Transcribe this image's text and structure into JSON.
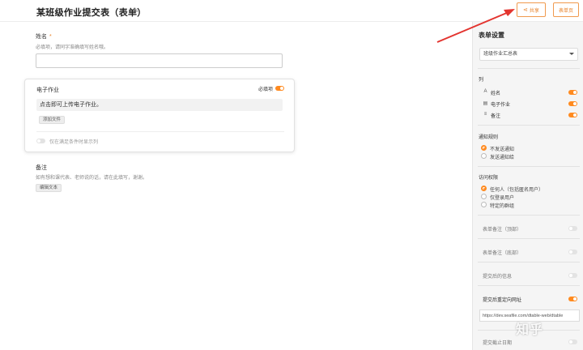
{
  "header": {
    "title": "某班级作业提交表（表单）",
    "share_label": "共享",
    "form_page_label": "表单页"
  },
  "form": {
    "name_field": {
      "label": "姓名",
      "required_mark": "*",
      "help": "必填项，请同字准确填写姓名哦。"
    },
    "file_field": {
      "title": "电子作业",
      "required_label": "必填项",
      "upload_hint": "点击即可上传电子作业。",
      "add_file_label": "添加文件",
      "condition_label": "仅在满足条件时显示列"
    },
    "note_field": {
      "label": "备注",
      "help": "如有想和课代表、老师说的话，请在此填写，谢谢。",
      "edit_text_label": "编辑文本"
    }
  },
  "panel": {
    "title": "表单设置",
    "table_select": "班级作业汇总表",
    "columns_label": "列",
    "columns": [
      {
        "icon": "A",
        "name": "姓名"
      },
      {
        "icon": "▤",
        "name": "电子作业"
      },
      {
        "icon": "≡",
        "name": "备注"
      }
    ],
    "notification_label": "通知规则",
    "notification_options": [
      "不发送通知",
      "发送通知给"
    ],
    "access_label": "访问权限",
    "access_options": [
      "任何人（包括匿名用户）",
      "仅登录用户",
      "特定的群组"
    ],
    "settings": [
      "表单备注（顶部）",
      "表单备注（底部）",
      "提交后的信息",
      "提交后重定向网址",
      "提交截止日期"
    ],
    "redirect_url": "https://dev.seafile.com/dtable-web/dtable"
  },
  "watermark": "知乎",
  "colors": {
    "accent": "#ff8a1f",
    "annotation_arrow": "#e3342f"
  }
}
